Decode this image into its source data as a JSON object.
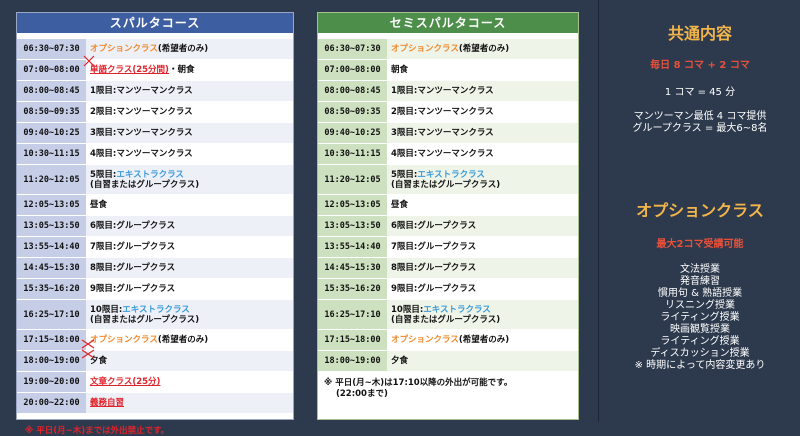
{
  "sparta": {
    "title": "スパルタコース",
    "rows": [
      {
        "time": "06:30~07:30",
        "parts": [
          {
            "t": "オプションクラス",
            "c": "orange"
          },
          {
            "t": "(希望者のみ)",
            "c": ""
          }
        ]
      },
      {
        "time": "07:00~08:00",
        "parts": [
          {
            "t": "単語クラス(25分間)",
            "c": "red ul"
          },
          {
            "t": "・朝食",
            "c": ""
          }
        ]
      },
      {
        "time": "08:00~08:45",
        "parts": [
          {
            "t": "1限目:マンツーマンクラス",
            "c": ""
          }
        ]
      },
      {
        "time": "08:50~09:35",
        "parts": [
          {
            "t": "2限目:マンツーマンクラス",
            "c": ""
          }
        ]
      },
      {
        "time": "09:40~10:25",
        "parts": [
          {
            "t": "3限目:マンツーマンクラス",
            "c": ""
          }
        ]
      },
      {
        "time": "10:30~11:15",
        "parts": [
          {
            "t": "4限目:マンツーマンクラス",
            "c": ""
          }
        ]
      },
      {
        "time": "11:20~12:05",
        "tall": true,
        "parts": [
          {
            "t": "5限目:",
            "c": ""
          },
          {
            "t": "エキストラクラス",
            "c": "blue"
          }
        ],
        "line2": "(自習またはグループクラス)"
      },
      {
        "time": "12:05~13:05",
        "parts": [
          {
            "t": "昼食",
            "c": ""
          }
        ]
      },
      {
        "time": "13:05~13:50",
        "parts": [
          {
            "t": "6限目:グループクラス",
            "c": ""
          }
        ]
      },
      {
        "time": "13:55~14:40",
        "parts": [
          {
            "t": "7限目:グループクラス",
            "c": ""
          }
        ]
      },
      {
        "time": "14:45~15:30",
        "parts": [
          {
            "t": "8限目:グループクラス",
            "c": ""
          }
        ]
      },
      {
        "time": "15:35~16:20",
        "parts": [
          {
            "t": "9限目:グループクラス",
            "c": ""
          }
        ]
      },
      {
        "time": "16:25~17:10",
        "tall": true,
        "parts": [
          {
            "t": "10限目:",
            "c": ""
          },
          {
            "t": "エキストラクラス",
            "c": "blue"
          }
        ],
        "line2": "(自習またはグループクラス)"
      },
      {
        "time": "17:15~18:00",
        "parts": [
          {
            "t": "オプションクラス",
            "c": "orange"
          },
          {
            "t": "(希望者のみ)",
            "c": ""
          }
        ]
      },
      {
        "time": "18:00~19:00",
        "parts": [
          {
            "t": "夕食",
            "c": ""
          }
        ]
      },
      {
        "time": "19:00~20:00",
        "parts": [
          {
            "t": "文章クラス(25分)",
            "c": "red ul"
          }
        ]
      },
      {
        "time": "20:00~22:00",
        "parts": [
          {
            "t": "義務自習",
            "c": "red ul"
          }
        ]
      }
    ],
    "note": "※ 平日(月~木)までは外出禁止です。"
  },
  "semi": {
    "title": "セミスパルタコース",
    "rows": [
      {
        "time": "06:30~07:30",
        "parts": [
          {
            "t": "オプションクラス",
            "c": "orange"
          },
          {
            "t": "(希望者のみ)",
            "c": ""
          }
        ]
      },
      {
        "time": "07:00~08:00",
        "parts": [
          {
            "t": "朝食",
            "c": ""
          }
        ]
      },
      {
        "time": "08:00~08:45",
        "parts": [
          {
            "t": "1限目:マンツーマンクラス",
            "c": ""
          }
        ]
      },
      {
        "time": "08:50~09:35",
        "parts": [
          {
            "t": "2限目:マンツーマンクラス",
            "c": ""
          }
        ]
      },
      {
        "time": "09:40~10:25",
        "parts": [
          {
            "t": "3限目:マンツーマンクラス",
            "c": ""
          }
        ]
      },
      {
        "time": "10:30~11:15",
        "parts": [
          {
            "t": "4限目:マンツーマンクラス",
            "c": ""
          }
        ]
      },
      {
        "time": "11:20~12:05",
        "tall": true,
        "parts": [
          {
            "t": "5限目:",
            "c": ""
          },
          {
            "t": "エキストラクラス",
            "c": "blue"
          }
        ],
        "line2": "(自習またはグループクラス)"
      },
      {
        "time": "12:05~13:05",
        "parts": [
          {
            "t": "昼食",
            "c": ""
          }
        ]
      },
      {
        "time": "13:05~13:50",
        "parts": [
          {
            "t": "6限目:グループクラス",
            "c": ""
          }
        ]
      },
      {
        "time": "13:55~14:40",
        "parts": [
          {
            "t": "7限目:グループクラス",
            "c": ""
          }
        ]
      },
      {
        "time": "14:45~15:30",
        "parts": [
          {
            "t": "8限目:グループクラス",
            "c": ""
          }
        ]
      },
      {
        "time": "15:35~16:20",
        "parts": [
          {
            "t": "9限目:グループクラス",
            "c": ""
          }
        ]
      },
      {
        "time": "16:25~17:10",
        "tall": true,
        "parts": [
          {
            "t": "10限目:",
            "c": ""
          },
          {
            "t": "エキストラクラス",
            "c": "blue"
          }
        ],
        "line2": "(自習またはグループクラス)"
      },
      {
        "time": "17:15~18:00",
        "parts": [
          {
            "t": "オプションクラス",
            "c": "orange"
          },
          {
            "t": "(希望者のみ)",
            "c": ""
          }
        ]
      },
      {
        "time": "18:00~19:00",
        "parts": [
          {
            "t": "夕食",
            "c": ""
          }
        ]
      }
    ],
    "note_line1": "※ 平日(月~木)は17:10以降の外出が可能です。",
    "note_line2": "(22:00まで)"
  },
  "common": {
    "title": "共通内容",
    "daily": "毎日 8 コマ + 2 コマ",
    "koma": "1 コマ = 45 分",
    "mtm": "マンツーマン最低 4 コマ提供",
    "group": "グループクラス = 最大6~8名"
  },
  "option": {
    "title": "オプションクラス",
    "max": "最大2コマ受講可能",
    "items": [
      "文法授業",
      "発音練習",
      "慣用句 & 熟語授業",
      "リスニング授業",
      "ライティング授業",
      "映画観覧授業",
      "ライティング授業",
      "ディスカッション授業",
      "※ 時期によって内容変更あり"
    ]
  },
  "colors": {
    "background": "#2d3a4d",
    "sparta_header": "#3e5ea2",
    "semi_header": "#4d8f4a",
    "accent_orange": "#f08a2e",
    "accent_red": "#e0232b",
    "accent_blue": "#3a9ad9",
    "title_gold": "#f3b54a"
  }
}
